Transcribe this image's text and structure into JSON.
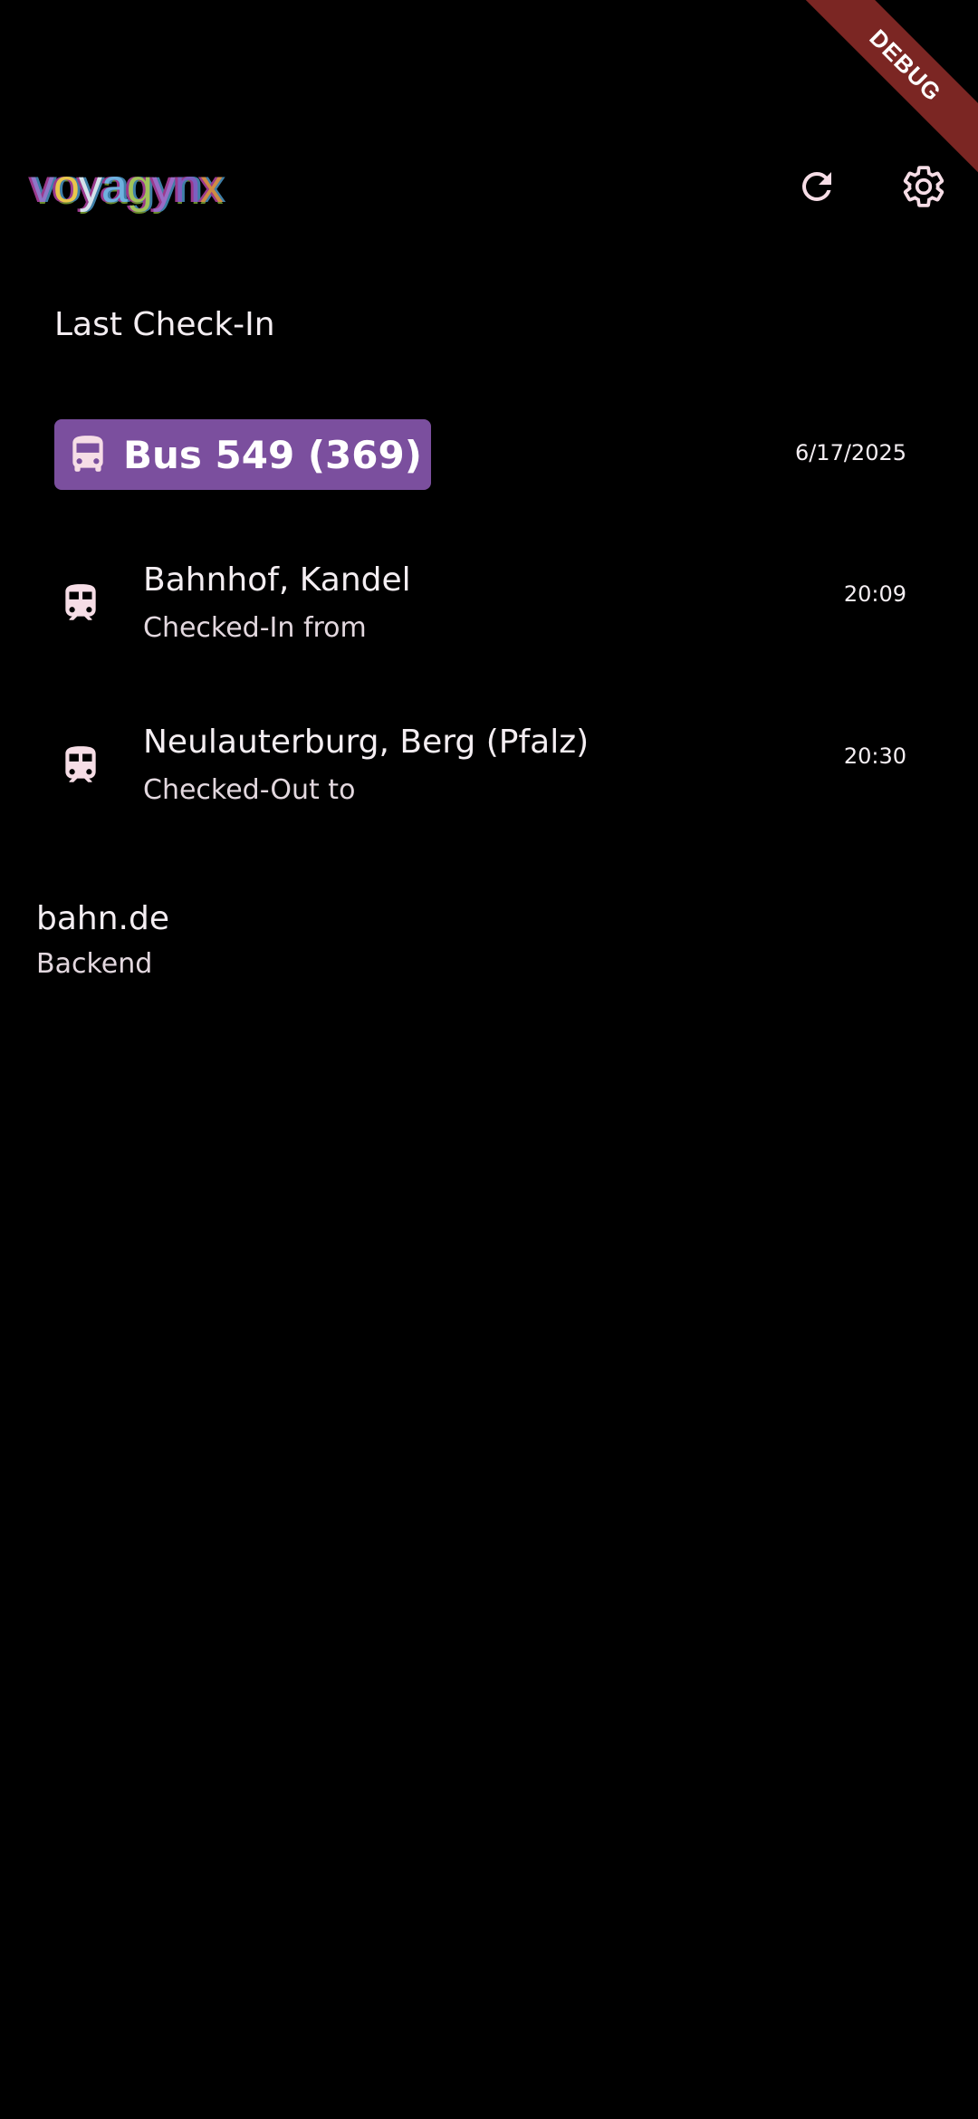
{
  "debug_banner": "DEBUG",
  "app_bar": {
    "logo_letters": [
      "v",
      "o",
      "y",
      "a",
      "g",
      "y",
      "n",
      "x"
    ],
    "refresh_icon": "refresh-icon",
    "settings_icon": "gear-icon"
  },
  "last_checkin": {
    "title": "Last Check-In",
    "line": {
      "label": "Bus 549 (369)",
      "icon": "bus-icon",
      "color": "#7b4f9e"
    },
    "date": "6/17/2025",
    "stops": [
      {
        "name": "Bahnhof, Kandel",
        "subtitle": "Checked-In from",
        "time": "20:09",
        "icon": "train-icon"
      },
      {
        "name": "Neulauterburg, Berg (Pfalz)",
        "subtitle": "Checked-Out to",
        "time": "20:30",
        "icon": "train-icon"
      }
    ]
  },
  "backend": {
    "name": "bahn.de",
    "label": "Backend"
  }
}
